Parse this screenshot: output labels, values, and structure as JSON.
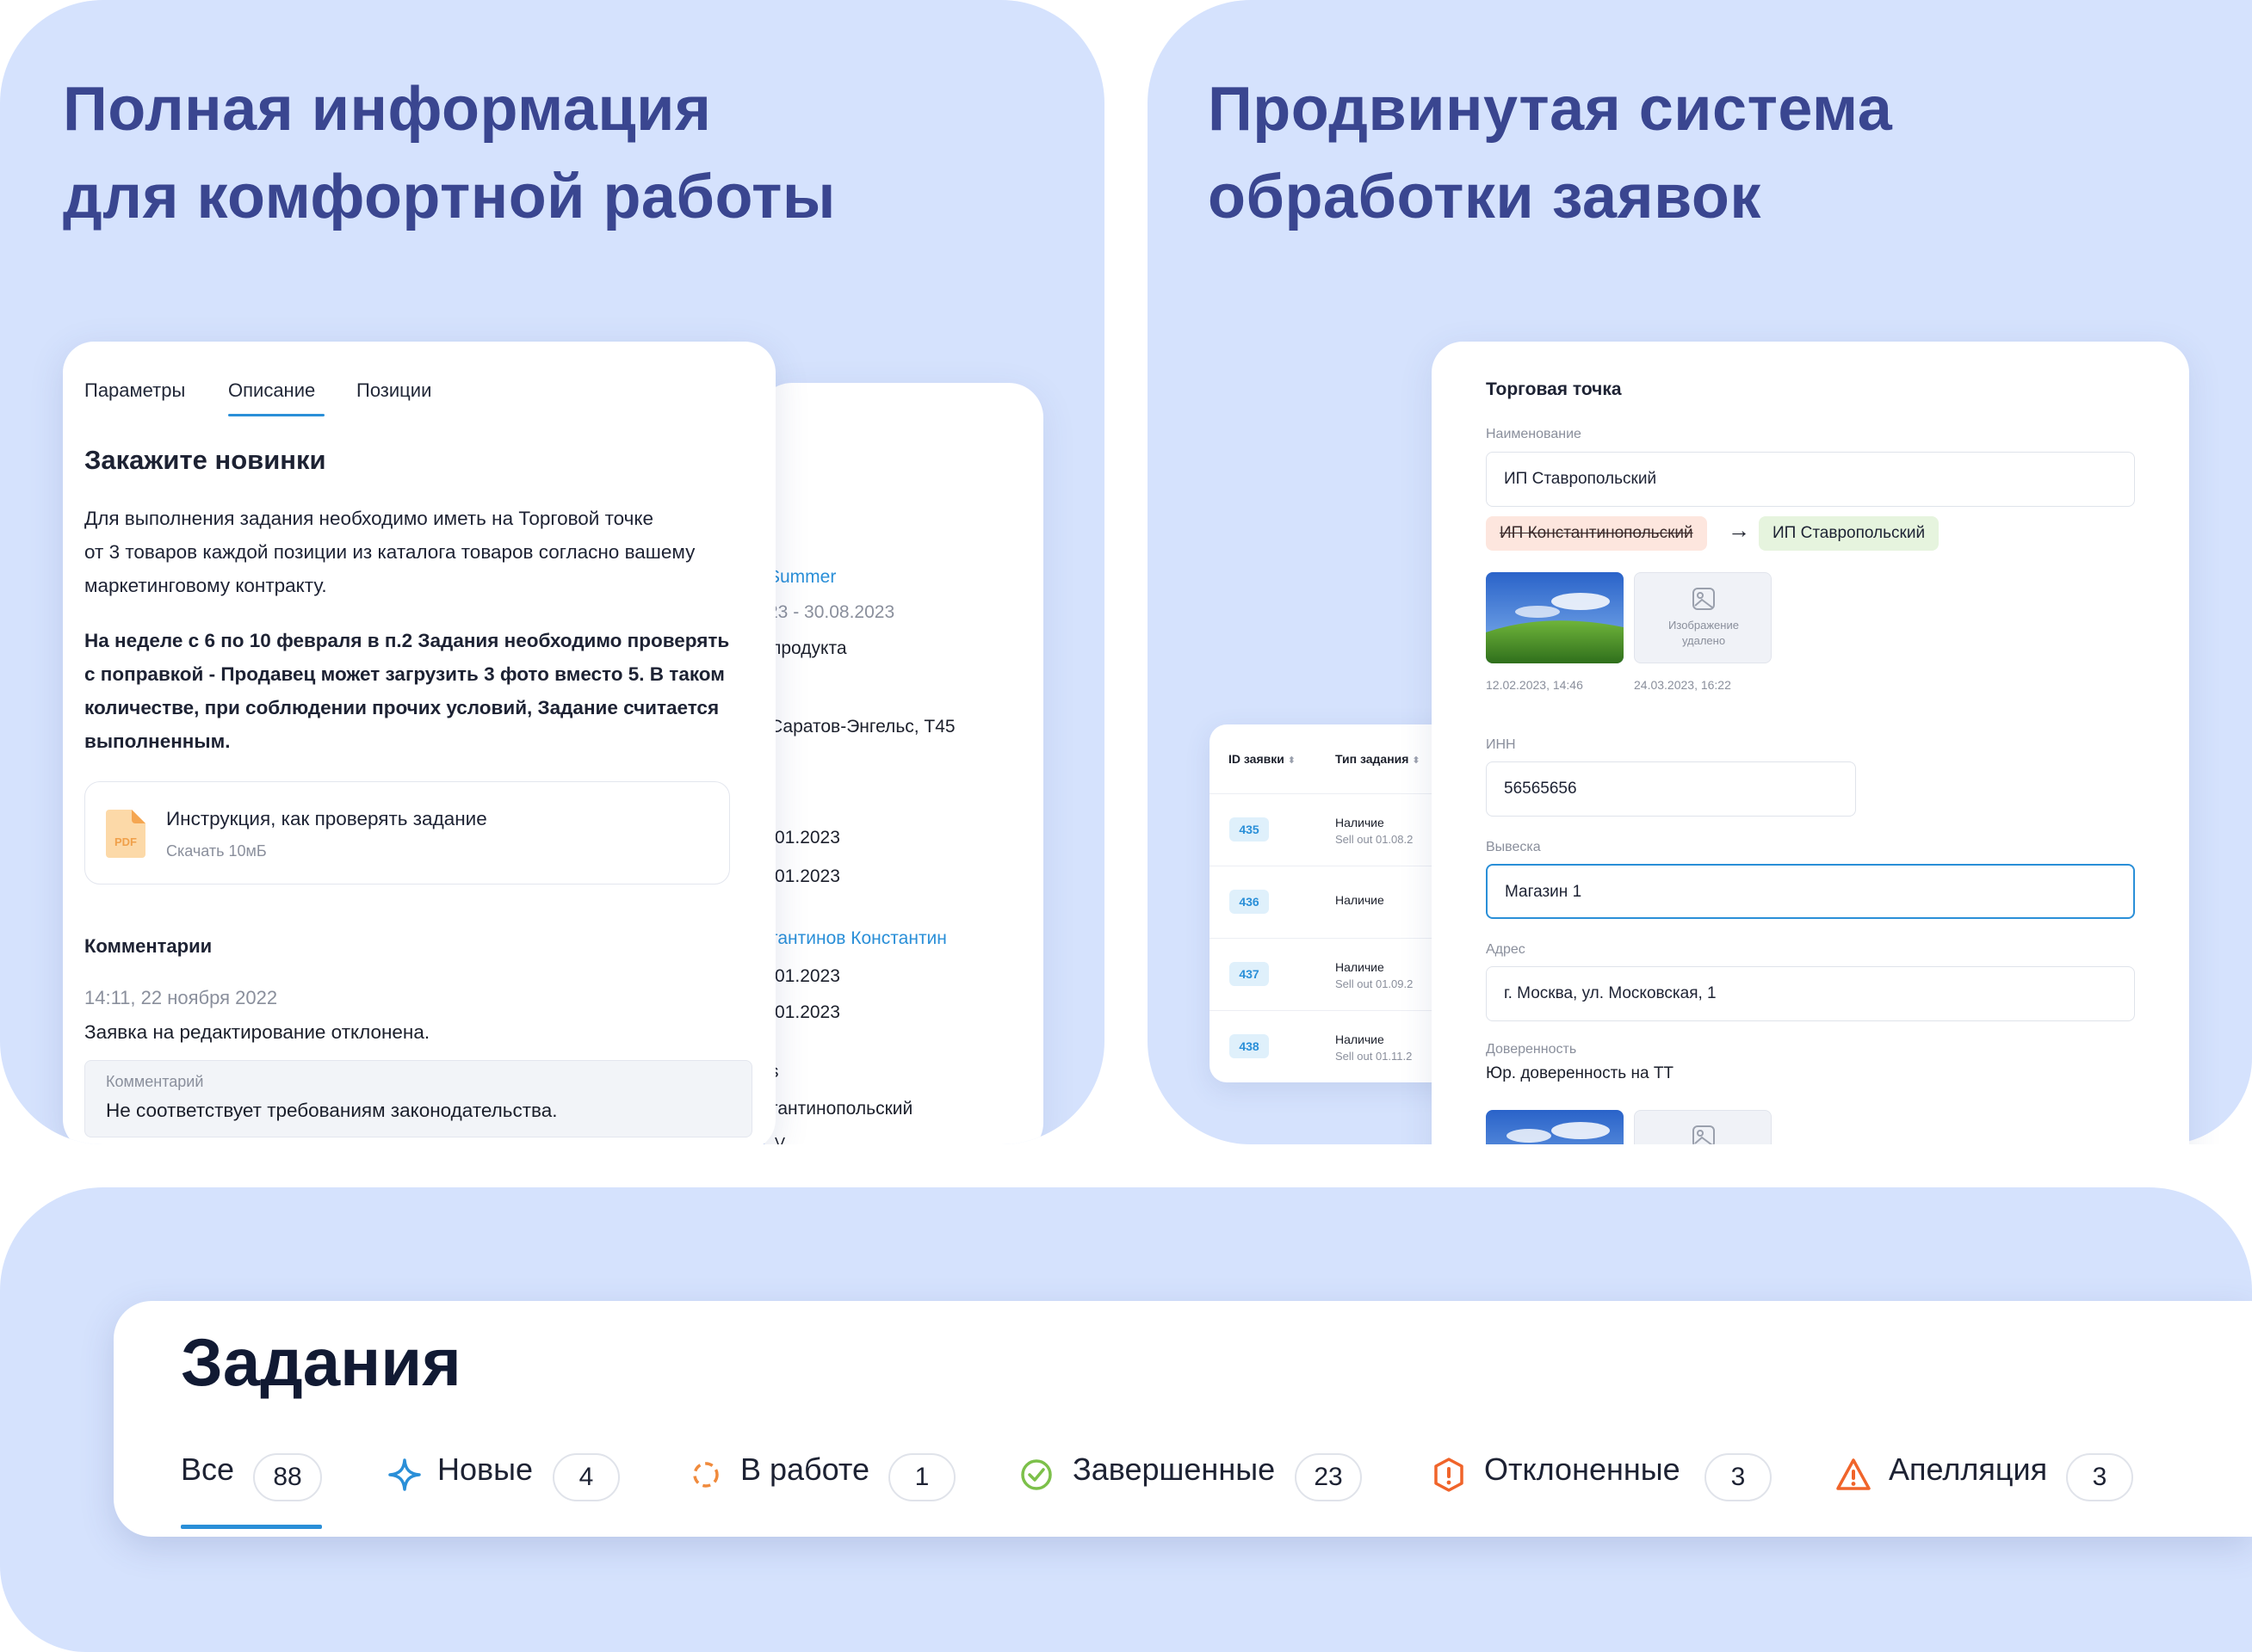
{
  "panel1": {
    "headline_line1": "Полная информация",
    "headline_line2": "для комфортной работы",
    "back_card": {
      "campaign": "Summer",
      "period": "23 - 30.08.2023",
      "product": "продукта",
      "address": "Саратов-Энгельс, Т45",
      "date1": "01.2023",
      "date2": "01.2023",
      "person": "тантинов Константин",
      "date3": "01.2023",
      "date4": "01.2023",
      "clipped_s": "s",
      "name": "тантинопольский",
      "clipped_bottom": "V"
    },
    "front_card": {
      "tabs": [
        "Параметры",
        "Описание",
        "Позиции"
      ],
      "active_tab": "Описание",
      "title": "Закажите новинки",
      "para1_l1": "Для выполнения задания необходимо иметь на Торговой точке",
      "para1_l2": "от 3 товаров каждой позиции из каталога товаров согласно вашему",
      "para1_l3": "маркетинговому контракту.",
      "para2_l1": "На неделе с 6 по 10 февраля в п.2 Задания необходимо проверять",
      "para2_l2": "с поправкой - Продавец может загрузить 3 фото вместо 5. В таком",
      "para2_l3": "количестве, при соблюдении прочих условий, Задание считается",
      "para2_l4": "выполненным.",
      "pdf_badge": "PDF",
      "pdf_title": "Инструкция, как проверять задание",
      "pdf_sub": "Скачать 10мБ",
      "comments_heading": "Комментарии",
      "comment_time": "14:11, 22 ноября 2022",
      "comment_text": "Заявка на  редактирование отклонена.",
      "comment_label": "Комментарий",
      "comment_body": "Не соответствует требованиям законодательства."
    }
  },
  "panel2": {
    "headline_line1": "Продвинутая система",
    "headline_line2": "обработки заявок",
    "table": {
      "col_id": "ID заявки",
      "col_type": "Тип задания",
      "rows": [
        {
          "id": "435",
          "type": "Наличие",
          "sub": "Sell out 01.08.2"
        },
        {
          "id": "436",
          "type": "Наличие",
          "sub": ""
        },
        {
          "id": "437",
          "type": "Наличие",
          "sub": "Sell out 01.09.2"
        },
        {
          "id": "438",
          "type": "Наличие",
          "sub": "Sell out 01.11.2"
        }
      ]
    },
    "form": {
      "section_title": "Торговая точка",
      "name_label": "Наименование",
      "name_value": "ИП Ставропольский",
      "old_name": "ИП Константинопольский",
      "arrow": "→",
      "new_name": "ИП Ставропольский",
      "deleted_image_text_l1": "Изображение",
      "deleted_image_text_l2": "удалено",
      "photo_date1": "12.02.2023, 14:46",
      "photo_date2": "24.03.2023, 16:22",
      "inn_label": "ИНН",
      "inn_value": "56565656",
      "sign_label": "Вывеска",
      "sign_value": "Магазин 1",
      "address_label": "Адрес",
      "address_value": "г. Москва, ул. Московская, 1",
      "trust_label": "Доверенность",
      "trust_value": "Юр. доверенность на ТТ"
    }
  },
  "panel3": {
    "title": "Задания",
    "statuses": [
      {
        "label": "Все",
        "count": "88",
        "icon": "none"
      },
      {
        "label": "Новые",
        "count": "4",
        "icon": "sparkle-icon"
      },
      {
        "label": "В работе",
        "count": "1",
        "icon": "spinner-icon"
      },
      {
        "label": "Завершенные",
        "count": "23",
        "icon": "check-circle-icon"
      },
      {
        "label": "Отклоненные",
        "count": "3",
        "icon": "exclamation-octagon-icon"
      },
      {
        "label": "Апелляция",
        "count": "3",
        "icon": "warning-triangle-icon"
      }
    ],
    "active_status": "Все"
  },
  "colors": {
    "panel_bg": "#d5e2fd",
    "headline": "#3a4690",
    "accent_blue": "#2a8fd8",
    "new_icon": "#2a8fd8",
    "in_work_icon": "#f08a3c",
    "done_icon": "#7cc04a",
    "rejected_icon": "#f0642a",
    "appeal_icon": "#f0642a"
  }
}
